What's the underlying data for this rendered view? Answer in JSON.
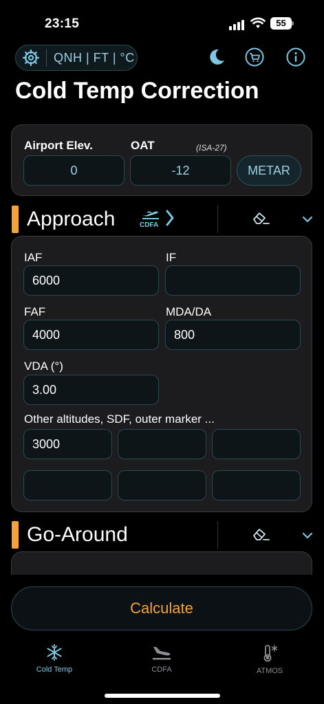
{
  "status": {
    "time": "23:15",
    "battery": "55"
  },
  "units": {
    "label": "QNH | FT | °C"
  },
  "title": "Cold Temp Correction",
  "airport": {
    "elev_label": "Airport Elev.",
    "elev_value": "0",
    "oat_label": "OAT",
    "isa_note": "(ISA-27)",
    "oat_value": "-12",
    "metar_button": "METAR"
  },
  "approach": {
    "title": "Approach",
    "cdfa_label": "CDFA",
    "fields": {
      "iaf_label": "IAF",
      "iaf_value": "6000",
      "if_label": "IF",
      "if_value": "",
      "faf_label": "FAF",
      "faf_value": "4000",
      "mda_label": "MDA/DA",
      "mda_value": "800",
      "vda_label": "VDA (°)",
      "vda_value": "3.00"
    },
    "other_label": "Other altitudes, SDF, outer marker ...",
    "other_values": [
      "3000",
      "",
      "",
      "",
      "",
      ""
    ]
  },
  "go_around": {
    "title": "Go-Around"
  },
  "calculate_button": "Calculate",
  "tabs": [
    {
      "label": "Cold Temp",
      "icon": "snowflake-icon",
      "active": true
    },
    {
      "label": "CDFA",
      "icon": "landing-plane-icon",
      "active": false
    },
    {
      "label": "ATMOS",
      "icon": "thermometer-icon",
      "active": false
    }
  ],
  "colors": {
    "accent": "#f5a339",
    "icon_blue": "#7ec8e3",
    "field_text": "#9fd0e3",
    "bg": "#000000",
    "card": "#1c1c1e"
  }
}
